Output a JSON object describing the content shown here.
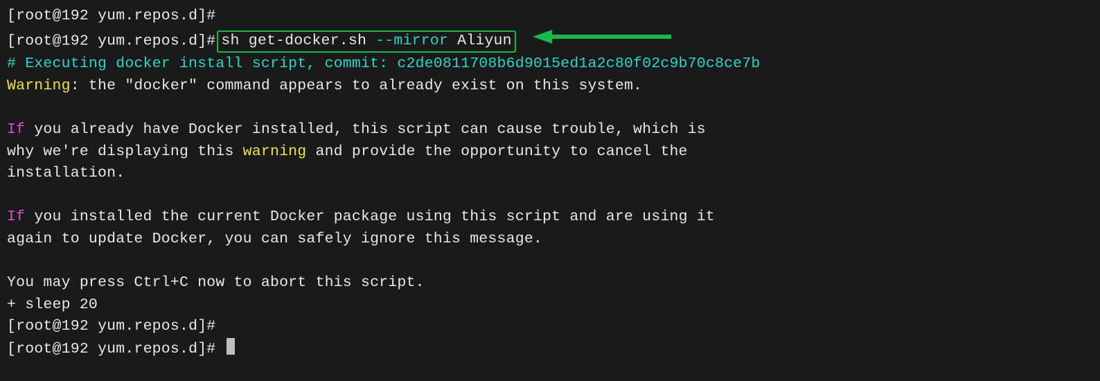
{
  "prompt": {
    "user": "root",
    "host": "192",
    "cwd": "yum.repos.d",
    "hash": "#"
  },
  "cmd": {
    "bin": "sh",
    "script": "get-docker.sh",
    "flag": "--mirror",
    "arg": "Aliyun"
  },
  "exec": {
    "prefix": "# Executing docker install script, commit: ",
    "commit": "c2de0811708b6d9015ed1a2c80f02c9b70c8ce7b"
  },
  "warn": {
    "label": "Warning",
    "text_after": ": the \"docker\" command appears to already exist on this system."
  },
  "para1": {
    "if": "If",
    "l1": " you already have Docker installed, this script can cause trouble, which is",
    "l2a": "why we're displaying this ",
    "warning": "warning",
    "l2b": " and provide the opportunity to cancel the",
    "l3": "installation."
  },
  "para2": {
    "if": "If",
    "l1": " you installed the current Docker package using this script and are using it",
    "l2": "again to update Docker, you can safely ignore this message."
  },
  "abort": "You may press Ctrl+C now to abort this script.",
  "sleep": "+ sleep 20",
  "arrow_color": "#19b84b"
}
